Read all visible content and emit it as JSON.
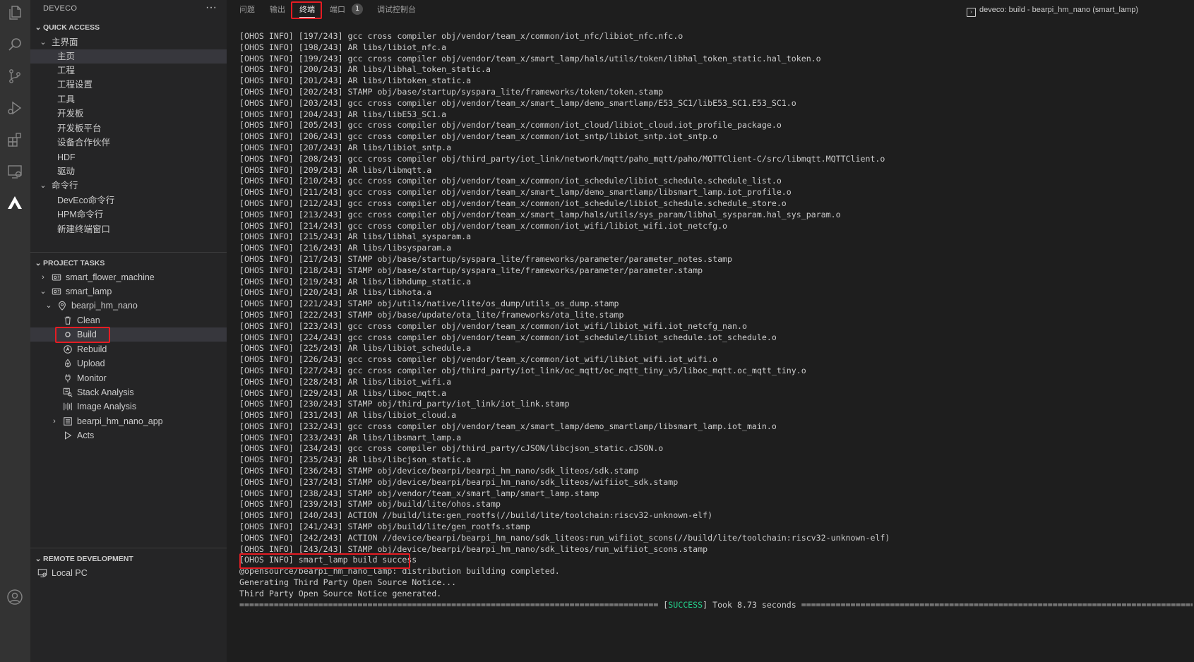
{
  "sidebar": {
    "title": "DEVECO",
    "more": "···",
    "quick_access": {
      "header": "QUICK ACCESS",
      "home_group": "主界面",
      "home_items": [
        "主页",
        "工程",
        "工程设置",
        "工具",
        "开发板",
        "开发板平台",
        "设备合作伙伴",
        "HDF",
        "驱动"
      ],
      "cmd_group": "命令行",
      "cmd_items": [
        "DevEco命令行",
        "HPM命令行",
        "新建终端窗口"
      ]
    },
    "project_tasks": {
      "header": "PROJECT TASKS",
      "projects": [
        "smart_flower_machine",
        "smart_lamp"
      ],
      "board": "bearpi_hm_nano",
      "tasks": [
        "Clean",
        "Build",
        "Rebuild",
        "Upload",
        "Monitor",
        "Stack Analysis",
        "Image Analysis",
        "bearpi_hm_nano_app",
        "Acts"
      ]
    },
    "remote": {
      "header": "REMOTE DEVELOPMENT",
      "item": "Local PC"
    }
  },
  "panel": {
    "tabs": [
      "问题",
      "输出",
      "终端",
      "端口",
      "调试控制台"
    ],
    "active_tab": "终端",
    "ports_badge": "1",
    "terminal_title": "deveco: build - bearpi_hm_nano (smart_lamp)"
  },
  "terminal": {
    "lines": [
      "[OHOS INFO] [197/243] gcc cross compiler obj/vendor/team_x/common/iot_nfc/libiot_nfc.nfc.o",
      "[OHOS INFO] [198/243] AR libs/libiot_nfc.a",
      "[OHOS INFO] [199/243] gcc cross compiler obj/vendor/team_x/smart_lamp/hals/utils/token/libhal_token_static.hal_token.o",
      "[OHOS INFO] [200/243] AR libs/libhal_token_static.a",
      "[OHOS INFO] [201/243] AR libs/libtoken_static.a",
      "[OHOS INFO] [202/243] STAMP obj/base/startup/syspara_lite/frameworks/token/token.stamp",
      "[OHOS INFO] [203/243] gcc cross compiler obj/vendor/team_x/smart_lamp/demo_smartlamp/E53_SC1/libE53_SC1.E53_SC1.o",
      "[OHOS INFO] [204/243] AR libs/libE53_SC1.a",
      "[OHOS INFO] [205/243] gcc cross compiler obj/vendor/team_x/common/iot_cloud/libiot_cloud.iot_profile_package.o",
      "[OHOS INFO] [206/243] gcc cross compiler obj/vendor/team_x/common/iot_sntp/libiot_sntp.iot_sntp.o",
      "[OHOS INFO] [207/243] AR libs/libiot_sntp.a",
      "[OHOS INFO] [208/243] gcc cross compiler obj/third_party/iot_link/network/mqtt/paho_mqtt/paho/MQTTClient-C/src/libmqtt.MQTTClient.o",
      "[OHOS INFO] [209/243] AR libs/libmqtt.a",
      "[OHOS INFO] [210/243] gcc cross compiler obj/vendor/team_x/common/iot_schedule/libiot_schedule.schedule_list.o",
      "[OHOS INFO] [211/243] gcc cross compiler obj/vendor/team_x/smart_lamp/demo_smartlamp/libsmart_lamp.iot_profile.o",
      "[OHOS INFO] [212/243] gcc cross compiler obj/vendor/team_x/common/iot_schedule/libiot_schedule.schedule_store.o",
      "[OHOS INFO] [213/243] gcc cross compiler obj/vendor/team_x/smart_lamp/hals/utils/sys_param/libhal_sysparam.hal_sys_param.o",
      "[OHOS INFO] [214/243] gcc cross compiler obj/vendor/team_x/common/iot_wifi/libiot_wifi.iot_netcfg.o",
      "[OHOS INFO] [215/243] AR libs/libhal_sysparam.a",
      "[OHOS INFO] [216/243] AR libs/libsysparam.a",
      "[OHOS INFO] [217/243] STAMP obj/base/startup/syspara_lite/frameworks/parameter/parameter_notes.stamp",
      "[OHOS INFO] [218/243] STAMP obj/base/startup/syspara_lite/frameworks/parameter/parameter.stamp",
      "[OHOS INFO] [219/243] AR libs/libhdump_static.a",
      "[OHOS INFO] [220/243] AR libs/libhota.a",
      "[OHOS INFO] [221/243] STAMP obj/utils/native/lite/os_dump/utils_os_dump.stamp",
      "[OHOS INFO] [222/243] STAMP obj/base/update/ota_lite/frameworks/ota_lite.stamp",
      "[OHOS INFO] [223/243] gcc cross compiler obj/vendor/team_x/common/iot_wifi/libiot_wifi.iot_netcfg_nan.o",
      "[OHOS INFO] [224/243] gcc cross compiler obj/vendor/team_x/common/iot_schedule/libiot_schedule.iot_schedule.o",
      "[OHOS INFO] [225/243] AR libs/libiot_schedule.a",
      "[OHOS INFO] [226/243] gcc cross compiler obj/vendor/team_x/common/iot_wifi/libiot_wifi.iot_wifi.o",
      "[OHOS INFO] [227/243] gcc cross compiler obj/third_party/iot_link/oc_mqtt/oc_mqtt_tiny_v5/liboc_mqtt.oc_mqtt_tiny.o",
      "[OHOS INFO] [228/243] AR libs/libiot_wifi.a",
      "[OHOS INFO] [229/243] AR libs/liboc_mqtt.a",
      "[OHOS INFO] [230/243] STAMP obj/third_party/iot_link/iot_link.stamp",
      "[OHOS INFO] [231/243] AR libs/libiot_cloud.a",
      "[OHOS INFO] [232/243] gcc cross compiler obj/vendor/team_x/smart_lamp/demo_smartlamp/libsmart_lamp.iot_main.o",
      "[OHOS INFO] [233/243] AR libs/libsmart_lamp.a",
      "[OHOS INFO] [234/243] gcc cross compiler obj/third_party/cJSON/libcjson_static.cJSON.o",
      "[OHOS INFO] [235/243] AR libs/libcjson_static.a",
      "[OHOS INFO] [236/243] STAMP obj/device/bearpi/bearpi_hm_nano/sdk_liteos/sdk.stamp",
      "[OHOS INFO] [237/243] STAMP obj/device/bearpi/bearpi_hm_nano/sdk_liteos/wifiiot_sdk.stamp",
      "[OHOS INFO] [238/243] STAMP obj/vendor/team_x/smart_lamp/smart_lamp.stamp",
      "[OHOS INFO] [239/243] STAMP obj/build/lite/ohos.stamp",
      "[OHOS INFO] [240/243] ACTION //build/lite:gen_rootfs(//build/lite/toolchain:riscv32-unknown-elf)",
      "[OHOS INFO] [241/243] STAMP obj/build/lite/gen_rootfs.stamp",
      "[OHOS INFO] [242/243] ACTION //device/bearpi/bearpi_hm_nano/sdk_liteos:run_wifiiot_scons(//build/lite/toolchain:riscv32-unknown-elf)",
      "[OHOS INFO] [243/243] STAMP obj/device/bearpi/bearpi_hm_nano/sdk_liteos/run_wifiiot_scons.stamp",
      "[OHOS INFO] smart_lamp build success",
      "@opensource/bearpi_hm_nano_lamp: distribution building completed.",
      "Generating Third Party Open Source Notice...",
      "Third Party Open Source Notice generated."
    ],
    "summary_left": "===================================================================================== [",
    "summary_status": "SUCCESS",
    "summary_right": "] Took 8.73 seconds ================================================================================="
  },
  "colors": {
    "highlight": "#e51c23",
    "success": "#23d18b"
  }
}
